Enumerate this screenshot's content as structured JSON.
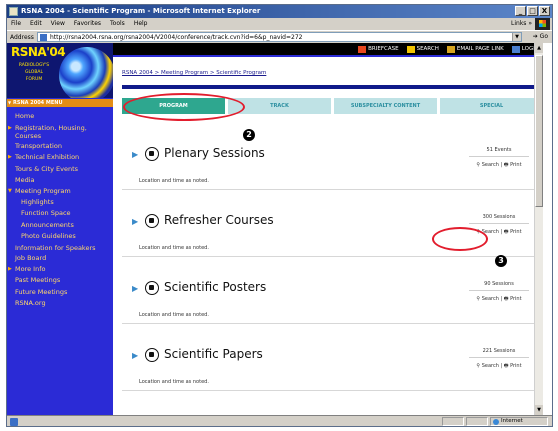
{
  "window": {
    "title": "RSNA 2004 - Scientific Program - Microsoft Internet Explorer",
    "controls": [
      "_",
      "□",
      "X"
    ]
  },
  "menubar": [
    "File",
    "Edit",
    "View",
    "Favorites",
    "Tools",
    "Help"
  ],
  "links_label": "Links »",
  "address": {
    "label": "Address",
    "url": "http://rsna2004.rsna.org/rsna2004/V2004/conference/track.cvn?id=6&p_navid=272",
    "go_label": "Go"
  },
  "sidebar": {
    "logo_text": "RSNA'04",
    "logo_sub": "RADIOLOGY'S GLOBAL FORUM",
    "menu_header": "RSNA 2004 MENU",
    "items": [
      {
        "label": "Home",
        "kind": "plain"
      },
      {
        "label": "Registration, Housing, Courses",
        "kind": "arrow-wrap"
      },
      {
        "label": "Transportation",
        "kind": "plain"
      },
      {
        "label": "Technical Exhibition",
        "kind": "arrow"
      },
      {
        "label": "Tours & City Events",
        "kind": "plain"
      },
      {
        "label": "Media",
        "kind": "plain"
      },
      {
        "label": "Meeting Program",
        "kind": "open"
      },
      {
        "label": "Highlights",
        "kind": "sub"
      },
      {
        "label": "Function Space",
        "kind": "sub"
      },
      {
        "label": "Announcements",
        "kind": "sub"
      },
      {
        "label": "Photo Guidelines",
        "kind": "sub"
      },
      {
        "label": "Information for Speakers",
        "kind": "wrap"
      },
      {
        "label": "Job Board",
        "kind": "plain"
      },
      {
        "label": "More Info",
        "kind": "arrow"
      },
      {
        "label": "Past Meetings",
        "kind": "plain"
      },
      {
        "label": "Future Meetings",
        "kind": "plain"
      },
      {
        "label": "RSNA.org",
        "kind": "plain"
      }
    ]
  },
  "topbar": {
    "links": [
      {
        "label": "BRIEFCASE",
        "color": "#e8461e"
      },
      {
        "label": "SEARCH",
        "color": "#f2c400"
      },
      {
        "label": "EMAIL PAGE LINK",
        "color": "#d7a520"
      },
      {
        "label": "LOGIN",
        "color": "#4a7fd0"
      }
    ]
  },
  "breadcrumb": "RSNA 2004 > Meeting Program > Scientific Program",
  "tabs": [
    {
      "label": "PROGRAM",
      "active": true
    },
    {
      "label": "TRACK",
      "active": false
    },
    {
      "label": "SUBSPECIALTY CONTENT",
      "active": false
    },
    {
      "label": "SPECIAL",
      "active": false
    }
  ],
  "annotations": {
    "badge_2": "2",
    "badge_3": "3",
    "highlight_color": "#e21d2d"
  },
  "sections": [
    {
      "title": "Plenary Sessions",
      "icon": "plenary-icon",
      "location": "Location and time as noted.",
      "count": "51 Events",
      "search": "Search",
      "print": "Print"
    },
    {
      "title": "Refresher Courses",
      "icon": "refresher-icon",
      "location": "Location and time as noted.",
      "count": "300 Sessions",
      "search": "Search",
      "print": "Print"
    },
    {
      "title": "Scientific Posters",
      "icon": "posters-icon",
      "location": "Location and time as noted.",
      "count": "90 Sessions",
      "search": "Search",
      "print": "Print"
    },
    {
      "title": "Scientific Papers",
      "icon": "papers-icon",
      "location": "Location and time as noted.",
      "count": "221 Sessions",
      "search": "Search",
      "print": "Print"
    }
  ],
  "status": {
    "zone": "Internet"
  },
  "colors": {
    "sidebar_bg": "#2b2bd6",
    "active_tab": "#2ea78f",
    "inactive_tab": "#bfe2e5",
    "nav_text": "#ffd86a"
  }
}
